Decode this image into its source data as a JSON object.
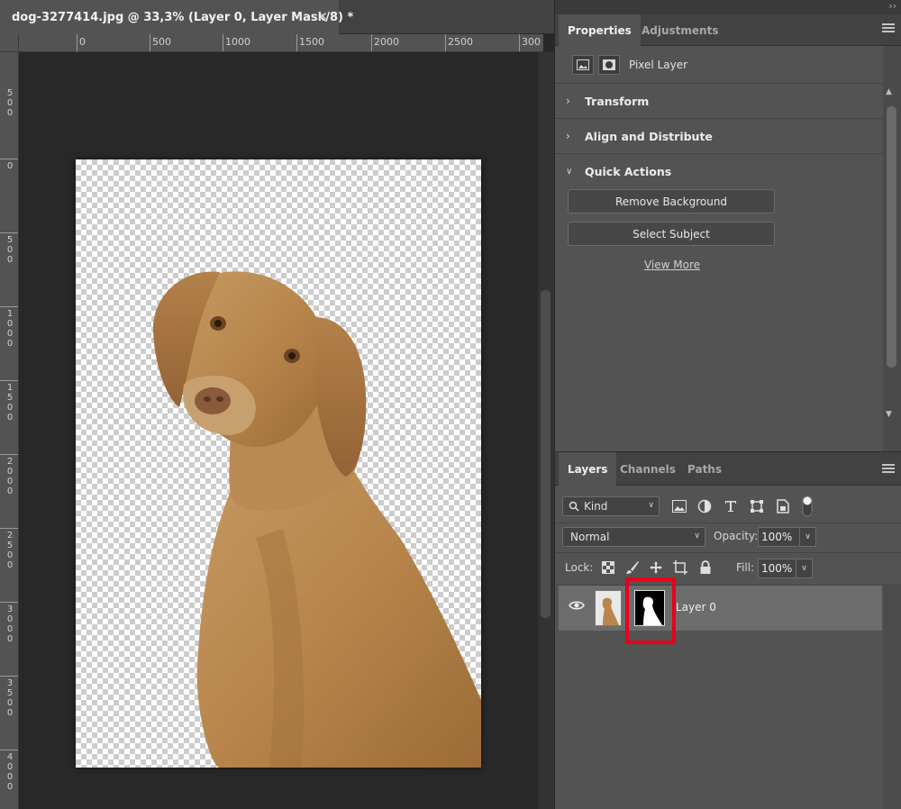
{
  "document": {
    "tab_title": "dog-3277414.jpg @ 33,3% (Layer 0, Layer Mask/8) *",
    "close_glyph": "✕",
    "ruler_h": [
      "0",
      "500",
      "1000",
      "1500",
      "2000",
      "2500",
      "300"
    ],
    "ruler_v": [
      "500",
      "0",
      "500",
      "1000",
      "1500",
      "2000",
      "2500",
      "3000",
      "3500",
      "4000"
    ]
  },
  "properties_panel": {
    "tabs": [
      "Properties",
      "Adjustments"
    ],
    "active_tab": "Properties",
    "pixel_layer_label": "Pixel Layer",
    "sections": {
      "transform": "Transform",
      "align": "Align and Distribute",
      "quick_actions": "Quick Actions"
    },
    "quick_actions": {
      "remove_background": "Remove Background",
      "select_subject": "Select Subject",
      "view_more": "View More"
    }
  },
  "layers_panel": {
    "tabs": [
      "Layers",
      "Channels",
      "Paths"
    ],
    "active_tab": "Layers",
    "filter_kind": "Kind",
    "blend_mode": "Normal",
    "opacity_label": "Opacity:",
    "opacity_value": "100%",
    "lock_label": "Lock:",
    "fill_label": "Fill:",
    "fill_value": "100%",
    "layers": [
      {
        "name": "Layer 0",
        "visible": true,
        "has_mask": true,
        "selected": true
      }
    ]
  },
  "colors": {
    "highlight": "#e8001c",
    "panel_bg": "#535353",
    "canvas_bg": "#282828"
  },
  "icons": [
    "close-icon",
    "panel-menu-icon",
    "chevron-right-icon",
    "chevron-down-icon",
    "pixel-layer-icon",
    "mask-icon",
    "search-icon",
    "image-filter-icon",
    "adjustment-filter-icon",
    "type-filter-icon",
    "shape-filter-icon",
    "smart-object-filter-icon",
    "filter-toggle-icon",
    "lock-transparent-icon",
    "lock-paint-icon",
    "lock-position-icon",
    "lock-artboard-icon",
    "lock-all-icon",
    "eye-icon"
  ]
}
